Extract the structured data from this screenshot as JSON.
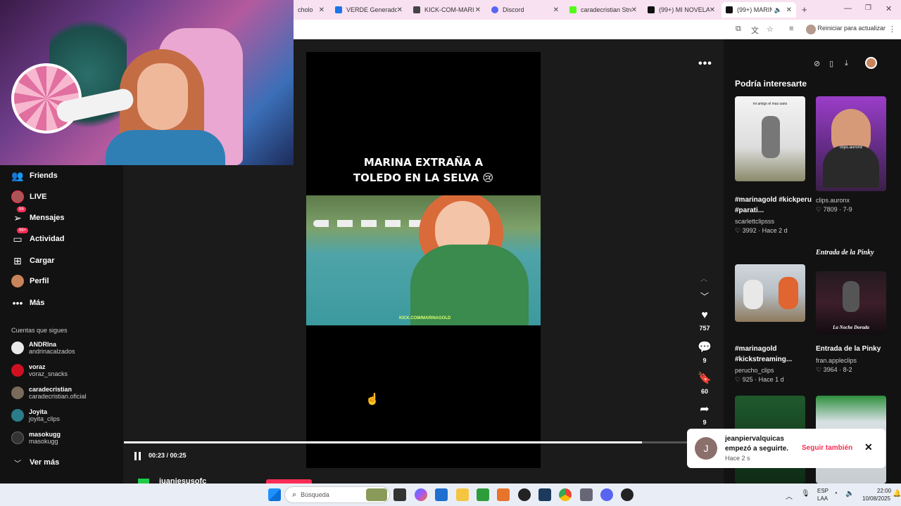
{
  "browser": {
    "tabs": [
      {
        "label": "cholo A...",
        "color": "#d9534f"
      },
      {
        "label": "VERDE Generador",
        "color": "#1a73e8"
      },
      {
        "label": "KICK-COM-MARI",
        "color": "#444444"
      },
      {
        "label": "Discord",
        "color": "#5865f2"
      },
      {
        "label": "caradecristian Stre",
        "color": "#53fc18"
      },
      {
        "label": "(99+) MI NOVELA",
        "color": "#111111"
      },
      {
        "label": "(99+) MARIN",
        "color": "#111111"
      }
    ],
    "reload_label": "Reiniciar para actualizar"
  },
  "sidebar": {
    "nav": [
      {
        "label": "Friends",
        "icon": "friends-icon"
      },
      {
        "label": "LIVE",
        "icon": "live-icon"
      },
      {
        "label": "Mensajes",
        "icon": "messages-icon",
        "badge": "55"
      },
      {
        "label": "Actividad",
        "icon": "activity-icon",
        "badge": "99+"
      },
      {
        "label": "Cargar",
        "icon": "upload-icon"
      },
      {
        "label": "Perfil",
        "icon": "profile-icon"
      },
      {
        "label": "Más",
        "icon": "more-icon"
      }
    ],
    "following_heading": "Cuentas que sigues",
    "following": [
      {
        "name": "ANDRIna",
        "handle": "andrinacalzados",
        "color": "#e9e9e9"
      },
      {
        "name": "voraz",
        "handle": "voraz_snacks",
        "color": "#d01020"
      },
      {
        "name": "caradecristian",
        "handle": "caradecristian.oficial",
        "color": "#7a6a5a"
      },
      {
        "name": "Joyita",
        "handle": "joyita_clips",
        "color": "#2b7c8a"
      },
      {
        "name": "masokugg",
        "handle": "masokugg",
        "color": "#333333"
      }
    ],
    "see_more": "Ver más"
  },
  "video": {
    "title_line1": "MARINA EXTRAÑA A",
    "title_line2": "TOLEDO EN LA SELVA 😢",
    "watermark": "KICK.COM/MARINAGOLD",
    "time": "00:23 / 00:25",
    "progress": 0.92,
    "likes": "757",
    "comments": "9",
    "saves": "60",
    "shares": "9",
    "creator": "juanjesusofc"
  },
  "recommendations": {
    "title": "Podría interesarte",
    "cards": [
      {
        "caption": "#marinagold #kickperu #parati...",
        "author": "scarlettclipsss",
        "likes": "3992",
        "age": "Hace 2 d",
        "overlay": "mi amigo el mas sano"
      },
      {
        "caption": "",
        "author": "clips.auronx",
        "likes": "7809",
        "age": "7-9",
        "overlay": "clips.auronx"
      },
      {
        "caption": "#marinagold #kickstreaming...",
        "author": "perucho_clips",
        "likes": "925",
        "age": "Hace 1 d",
        "overlay": ""
      },
      {
        "caption": "Entrada de la Pinky",
        "author": "fran.appleclips",
        "likes": "3964",
        "age": "8-2",
        "overlay": "La Noche Dorada"
      }
    ],
    "heading_pinky": "Entrada de la Pinky"
  },
  "toast": {
    "initial": "J",
    "name": "jeanpiervalquicas",
    "message": "empezó a seguirte.",
    "time": "Hace 2 s",
    "action": "Seguir también"
  },
  "taskbar": {
    "search_placeholder": "Búsqueda",
    "lang": "ESP",
    "region": "LAA",
    "clock": "22:00",
    "date": "10/08/2025"
  }
}
